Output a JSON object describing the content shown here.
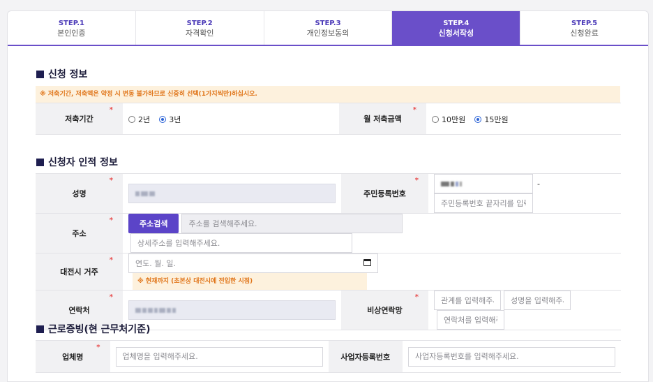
{
  "steps": [
    {
      "num": "STEP.1",
      "label": "본인인증"
    },
    {
      "num": "STEP.2",
      "label": "자격확인"
    },
    {
      "num": "STEP.3",
      "label": "개인정보동의"
    },
    {
      "num": "STEP.4",
      "label": "신청서작성"
    },
    {
      "num": "STEP.5",
      "label": "신청완료"
    }
  ],
  "active_step": "STEP.4",
  "section1": {
    "title": "신청 정보",
    "notice": "※ 저축기간, 저축액은 약정 시 변동 불가하므로 신중히 선택(1가지씩만)하십시오.",
    "period_label": "저축기간",
    "period_options": [
      "2년",
      "3년"
    ],
    "period_selected": "3년",
    "amount_label": "월 저축금액",
    "amount_options": [
      "10만원",
      "15만원"
    ],
    "amount_selected": "15만원"
  },
  "section2": {
    "title": "신청자 인적 정보",
    "name_label": "성명",
    "rrn_label": "주민등록번호",
    "rrn_dash": "-",
    "rrn_back_placeholder": "주민등록번호 끝자리를 입력해주세요.",
    "addr_label": "주소",
    "addr_search_button": "주소검색",
    "addr_placeholder": "주소를 검색해주세요.",
    "addr_detail_placeholder": "상세주소를 입력해주세요.",
    "residence_label": "대전시 거주",
    "residence_date_placeholder": "연도. 월. 일.",
    "residence_hint": "※ 현재까지 (초본상 대전시에 전입한 시점)",
    "phone_label": "연락처",
    "emergency_label": "비상연락망",
    "emergency_relation_placeholder": "관계를 입력해주세요.",
    "emergency_name_placeholder": "성명을 입력해주세요.",
    "emergency_phone_placeholder": "연락처를 입력해주세요."
  },
  "section3": {
    "title": "근로증빙(현 근무처기준)",
    "company_label": "업체명",
    "company_placeholder": "업체명을 입력해주세요.",
    "bizno_label": "사업자등록번호",
    "bizno_placeholder": "사업자등록번호를 입력해주세요."
  },
  "required_mark": "*",
  "colors": {
    "accent": "#6a4fc9",
    "button": "#5b44c8",
    "notice_bg": "#fdf1dd",
    "notice_text": "#e0761b"
  }
}
